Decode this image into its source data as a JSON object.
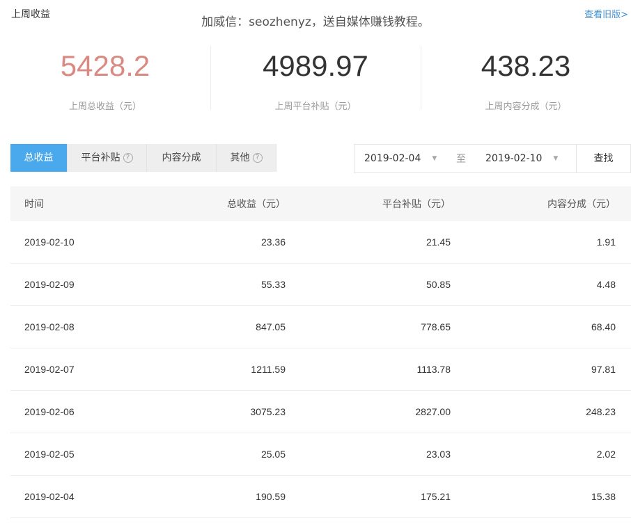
{
  "header": {
    "section_title": "上周收益",
    "banner": "加威信：seozhenyz，送自媒体赚钱教程。",
    "old_version_link": "查看旧版>"
  },
  "summary": [
    {
      "value": "5428.2",
      "label": "上周总收益（元）"
    },
    {
      "value": "4989.97",
      "label": "上周平台补贴（元）"
    },
    {
      "value": "438.23",
      "label": "上周内容分成（元）"
    }
  ],
  "colors": {
    "accent_value": "#d98a82",
    "active_tab": "#4aa8ec",
    "link": "#3f8fd0"
  },
  "tabs": [
    {
      "label": "总收益",
      "active": true,
      "help": false
    },
    {
      "label": "平台补贴",
      "active": false,
      "help": true
    },
    {
      "label": "内容分成",
      "active": false,
      "help": false
    },
    {
      "label": "其他",
      "active": false,
      "help": true
    }
  ],
  "icons": {
    "help": "question-circle-icon",
    "dropdown": "chevron-down-icon"
  },
  "help_glyph": "?",
  "date_filter": {
    "start": "2019-02-04",
    "separator": "至",
    "end": "2019-02-10",
    "search_label": "查找"
  },
  "table": {
    "headers": [
      "时间",
      "总收益（元）",
      "平台补贴（元）",
      "内容分成（元）"
    ],
    "rows": [
      [
        "2019-02-10",
        "23.36",
        "21.45",
        "1.91"
      ],
      [
        "2019-02-09",
        "55.33",
        "50.85",
        "4.48"
      ],
      [
        "2019-02-08",
        "847.05",
        "778.65",
        "68.40"
      ],
      [
        "2019-02-07",
        "1211.59",
        "1113.78",
        "97.81"
      ],
      [
        "2019-02-06",
        "3075.23",
        "2827.00",
        "248.23"
      ],
      [
        "2019-02-05",
        "25.05",
        "23.03",
        "2.02"
      ],
      [
        "2019-02-04",
        "190.59",
        "175.21",
        "15.38"
      ]
    ]
  }
}
